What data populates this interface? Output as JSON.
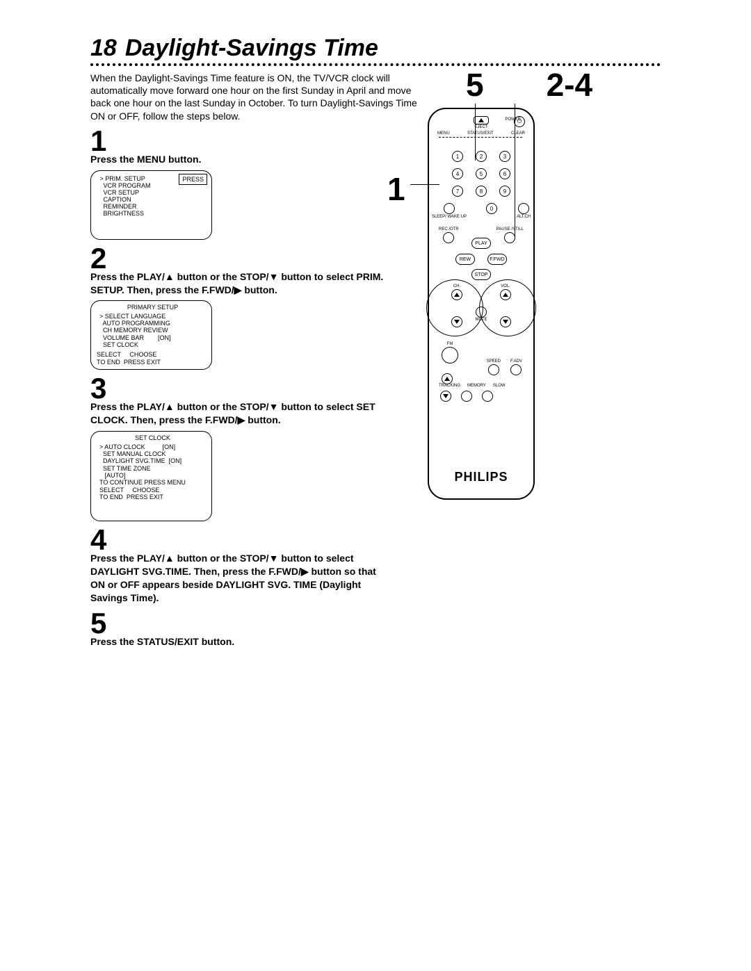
{
  "header": {
    "page_num": "18",
    "title": "Daylight-Savings Time"
  },
  "intro": "When the Daylight-Savings Time feature is ON, the TV/VCR clock will automatically move forward one hour on the first Sunday in April and move back one hour on the last Sunday in October. To turn Daylight-Savings Time ON or OFF, follow the steps below.",
  "steps": [
    {
      "num": "1",
      "text": "Press the MENU button."
    },
    {
      "num": "2",
      "text": "Press the PLAY/▲ button or the STOP/▼ button to select PRIM. SETUP.  Then, press the F.FWD/▶ button."
    },
    {
      "num": "3",
      "text": "Press the PLAY/▲ button or the STOP/▼ button to select SET CLOCK. Then, press the F.FWD/▶ button."
    },
    {
      "num": "4",
      "text": "Press the PLAY/▲ button or the STOP/▼ button to select DAYLIGHT SVG.TIME. Then, press the F.FWD/▶ button so that ON or OFF appears beside DAYLIGHT SVG. TIME (Daylight Savings Time)."
    },
    {
      "num": "5",
      "text": "Press the STATUS/EXIT button."
    }
  ],
  "screens": [
    {
      "press": "PRESS",
      "l0": " > PRIM. SETUP",
      "l1": "   VCR PROGRAM",
      "l2": "   VCR SETUP",
      "l3": "   CAPTION",
      "l4": "   REMINDER",
      "l5": "   BRIGHTNESS"
    },
    {
      "title": "PRIMARY SETUP",
      "l0": "> SELECT LANGUAGE",
      "l1": "  AUTO PROGRAMMING",
      "l2": "  CH MEMORY REVIEW",
      "l3": "  VOLUME BAR        [ON]",
      "l4": "  SET CLOCK",
      "f0": "SELECT     CHOOSE",
      "f1": "TO END  PRESS EXIT"
    },
    {
      "title": "SET CLOCK",
      "l0": "> AUTO CLOCK          [ON]",
      "l1": "  SET MANUAL CLOCK",
      "l2": "  DAYLIGHT SVG.TIME  [ON]",
      "l3": "  SET TIME ZONE",
      "l4": "   [AUTO]",
      "f0": "TO CONTINUE PRESS MENU",
      "f1": "SELECT     CHOOSE",
      "f2": "TO END  PRESS EXIT"
    }
  ],
  "callouts": {
    "c1": "1",
    "c5": "5",
    "c24": "2-4"
  },
  "remote": {
    "brand": "PHILIPS",
    "eject": "EJECT",
    "power": "POWER",
    "menu": "MENU",
    "status": "STATUS/EXIT",
    "clear": "CLEAR",
    "sleep": "SLEEP/\nWAKE UP",
    "altch": "ALT.CH",
    "rec": "REC\n/OTR",
    "pause": "PAUSE\n/STILL",
    "play": "PLAY",
    "rew": "REW",
    "ffwd": "F.FWD",
    "stop": "STOP",
    "ch": "CH.",
    "vol": "VOL.",
    "mute": "MUTE",
    "fm": "FM",
    "speed": "SPEED",
    "fadv": "F.ADV",
    "tracking": "TRACKING",
    "memory": "MEMORY",
    "slow": "SLOW"
  }
}
